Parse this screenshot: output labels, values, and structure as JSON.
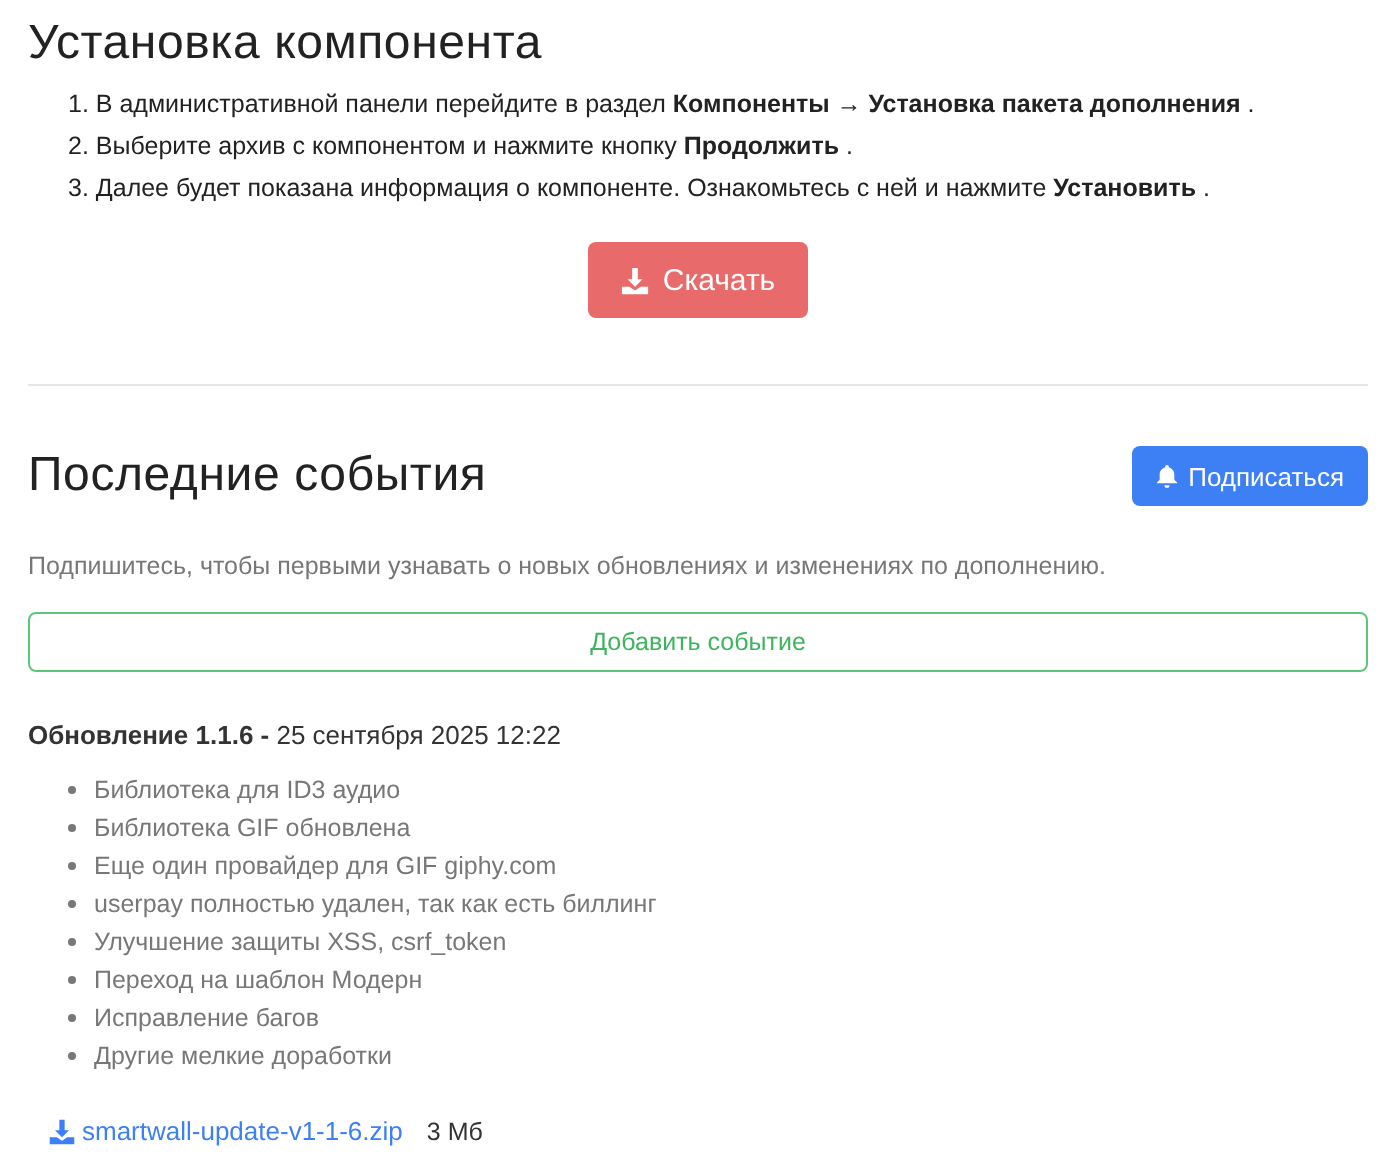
{
  "install": {
    "title": "Установка компонента",
    "steps": [
      "1. В административной панели перейдите в раздел **Компоненты → Установка пакета дополнения** .",
      "2. Выберите архив с компонентом и нажмите кнопку **Продолжить** .",
      "3. Далее будет показана информация о компоненте. Ознакомьтесь с ней и нажмите **Установить** ."
    ],
    "download_button": "Скачать"
  },
  "events": {
    "title": "Последние события",
    "subscribe_button": "Подписаться",
    "hint": "Подпишитесь, чтобы первыми узнавать о новых обновлениях и изменениях по дополнению.",
    "add_button": "Добавить событие",
    "update": {
      "heading": "**Обновление 1.1.6 -** 25 сентября 2025 12:22",
      "changes": [
        "Библиотека для ID3 аудио",
        "Библиотека GIF обновлена",
        "Еще один провайдер для GIF giphy.com",
        "userpay полностью удален, так как есть биллинг",
        "Улучшение защиты XSS, csrf_token",
        "Переход на шаблон Модерн",
        "Исправление багов",
        "Другие мелкие доработки"
      ],
      "file": {
        "name": "smartwall-update-v1-1-6.zip",
        "size": "3 Мб"
      }
    }
  }
}
